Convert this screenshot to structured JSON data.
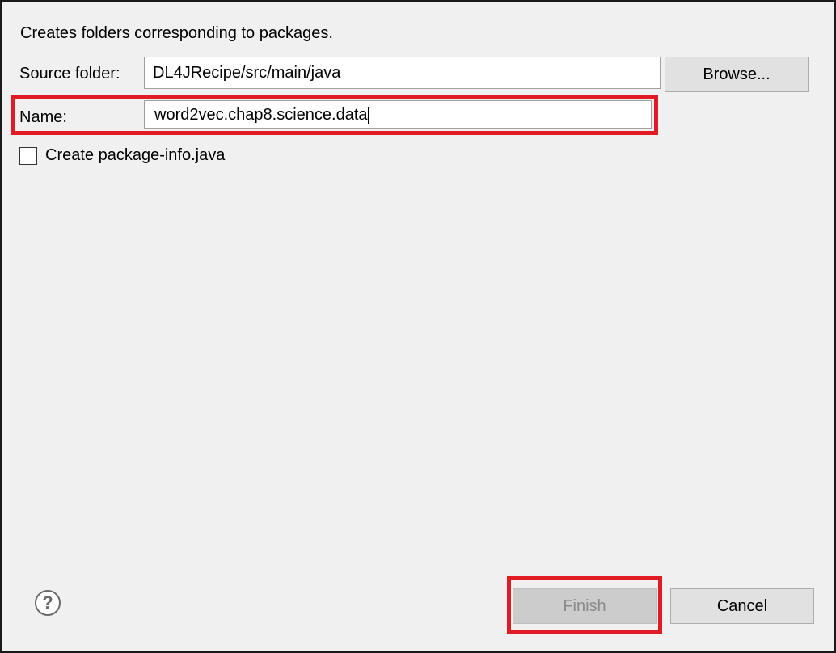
{
  "dialog": {
    "description": "Creates folders corresponding to packages.",
    "source_folder": {
      "label": "Source folder:",
      "value": "DL4JRecipe/src/main/java",
      "browse_label": "Browse..."
    },
    "name": {
      "label": "Name:",
      "value": "word2vec.chap8.science.data"
    },
    "package_info": {
      "label": "Create package-info.java",
      "checked": false
    }
  },
  "footer": {
    "help_icon": "help-icon",
    "finish_label": "Finish",
    "cancel_label": "Cancel"
  },
  "colors": {
    "highlight": "#e01b24",
    "background": "#f0f0f0",
    "button": "#e1e1e1",
    "disabled_button": "#cccccc"
  }
}
